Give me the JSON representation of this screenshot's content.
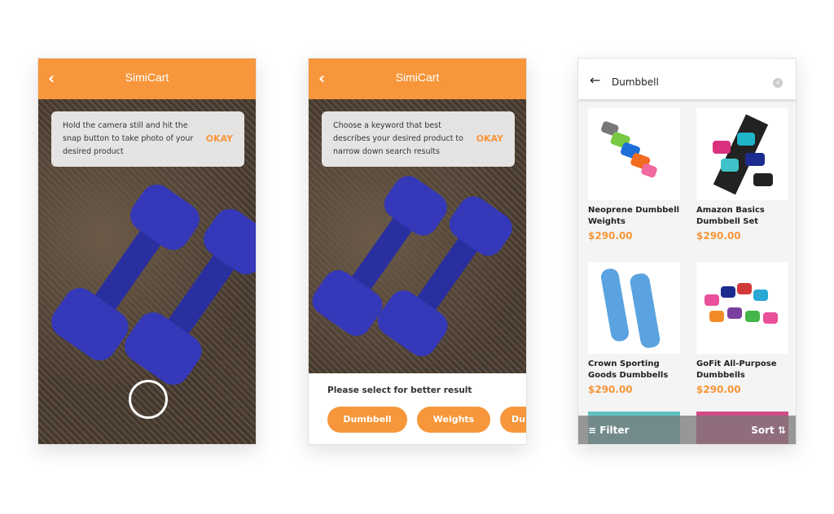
{
  "brand": {
    "name": "SimiCart",
    "accent": "#f7963a"
  },
  "screen1": {
    "back_icon": "chevron-left",
    "tip": "Hold the camera still and hit the snap button to take photo of your desired product",
    "okay": "OKAY"
  },
  "screen2": {
    "back_icon": "chevron-left",
    "tip": "Choose a keyword that best describes your desired product to narrow down search results",
    "okay": "OKAY",
    "prompt": "Please select for better result",
    "chips": [
      "Dumbbell",
      "Weights",
      "Dumbbells"
    ]
  },
  "screen3": {
    "search_value": "Dumbbell",
    "products": [
      {
        "name": "Neoprene Dumbbell Weights",
        "price": "$290.00"
      },
      {
        "name": "Amazon Basics Dumbbell Set",
        "price": "$290.00"
      },
      {
        "name": "Crown Sporting Goods Dumbbells",
        "price": "$290.00"
      },
      {
        "name": "GoFit All-Purpose Dumbbells",
        "price": "$290.00"
      }
    ],
    "filter": "Filter",
    "sort": "Sort"
  }
}
